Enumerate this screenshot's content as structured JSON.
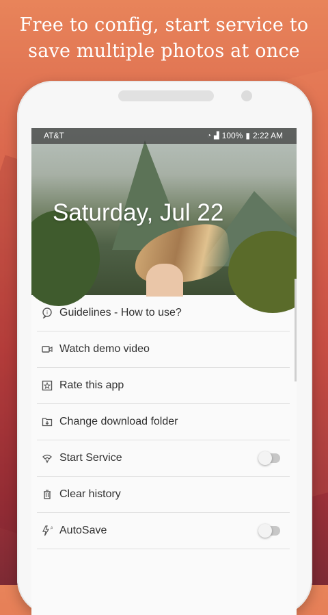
{
  "headline": {
    "line1": "Free to config, start service to",
    "line2": "save multiple photos at once"
  },
  "status_bar": {
    "carrier": "AT&T",
    "battery_text": "100%",
    "time": "2:22 AM"
  },
  "header": {
    "date": "Saturday, Jul 22"
  },
  "menu": {
    "items": [
      {
        "label": "Guidelines - How to use?",
        "icon": "help-bubble-icon"
      },
      {
        "label": "Watch demo video",
        "icon": "video-camera-icon"
      },
      {
        "label": "Rate this app",
        "icon": "star-box-icon"
      },
      {
        "label": "Change download folder",
        "icon": "folder-download-icon"
      },
      {
        "label": "Start Service",
        "icon": "service-icon",
        "toggle": false
      },
      {
        "label": "Clear history",
        "icon": "trash-icon"
      },
      {
        "label": "AutoSave",
        "icon": "flash-auto-icon",
        "toggle": false
      }
    ]
  },
  "colors": {
    "accent_background": "#d9644c",
    "text": "#303030"
  }
}
